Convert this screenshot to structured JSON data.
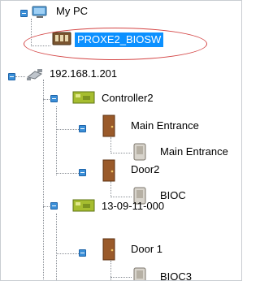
{
  "tree": {
    "root": {
      "label": "My PC",
      "icon": "computer-icon"
    },
    "local_device": {
      "label": "PROXE2_BIOSW",
      "icon": "controller-box-icon",
      "selected": true
    },
    "host": {
      "label": "192.168.1.201",
      "icon": "network-camera-icon"
    },
    "controllers": [
      {
        "label": "Controller2",
        "icon": "controller-board-icon"
      },
      {
        "label": "13-09-11-000",
        "icon": "controller-board-icon"
      }
    ],
    "doors": [
      {
        "label": "Main Entrance",
        "icon": "door-icon"
      },
      {
        "label": "Door2",
        "icon": "door-icon"
      },
      {
        "label": "Door 1",
        "icon": "door-icon"
      }
    ],
    "readers": [
      {
        "label": "Main Entrance",
        "icon": "reader-icon"
      },
      {
        "label": "BIOC",
        "icon": "reader-icon"
      },
      {
        "label": "BIOC3",
        "icon": "reader-icon"
      }
    ]
  },
  "colors": {
    "selection": "#0b90ff",
    "highlight_ring": "#d44545",
    "toggle": "#3a8fd8"
  }
}
